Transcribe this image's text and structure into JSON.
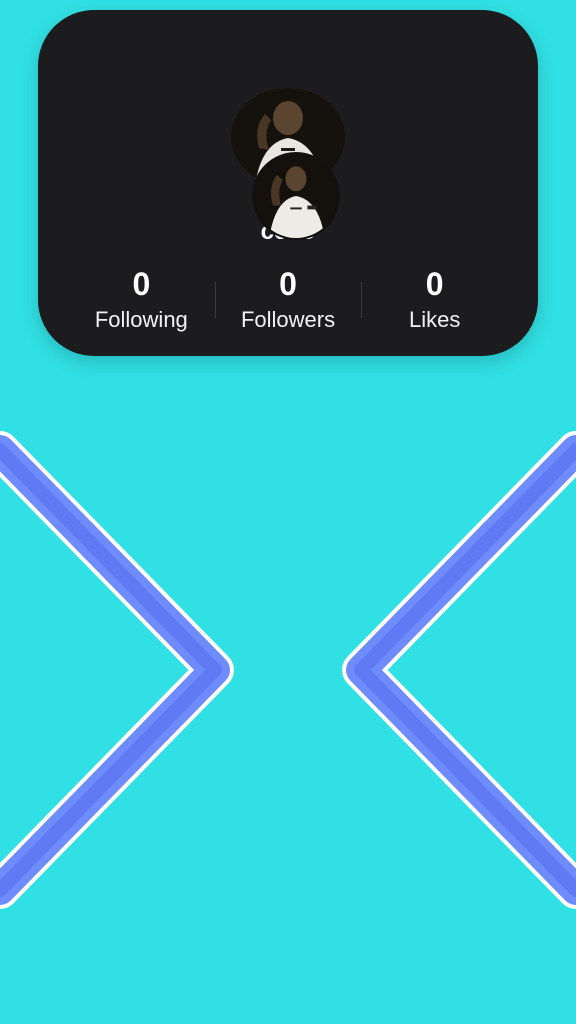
{
  "profile": {
    "username": "celio"
  },
  "stats": [
    {
      "value": "0",
      "label": "Following"
    },
    {
      "value": "0",
      "label": "Followers"
    },
    {
      "value": "0",
      "label": "Likes"
    }
  ],
  "colors": {
    "background": "#31e0e4",
    "card": "#1c1c1e",
    "chevron": "#6f8cff",
    "text": "#ffffff"
  },
  "navigation": {
    "previous_icon": "chevron-left-icon",
    "next_icon": "chevron-right-icon"
  }
}
